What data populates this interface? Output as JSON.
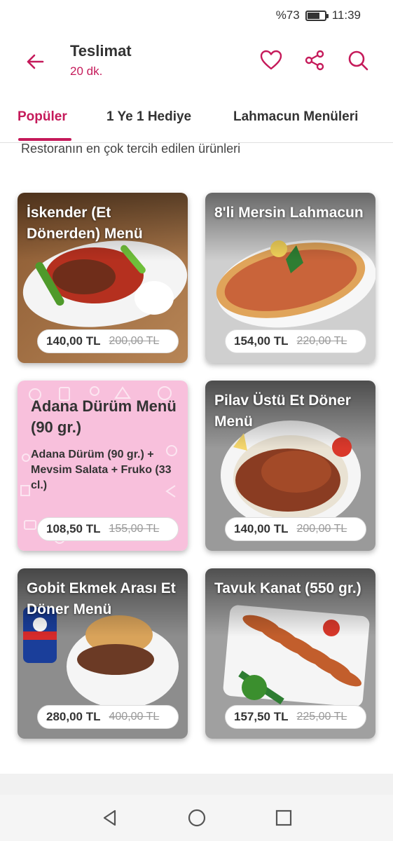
{
  "status_bar": {
    "battery": "%73",
    "time": "11:39",
    "battery_level": 0.73
  },
  "header": {
    "title": "Teslimat",
    "subtitle": "20 dk."
  },
  "icons": {
    "back": "arrow-left-icon",
    "favorite": "heart-icon",
    "share": "share-icon",
    "search": "search-icon"
  },
  "colors": {
    "accent": "#c51a5a",
    "pink_card": "#f8c0dc"
  },
  "tabs": [
    {
      "label": "Popüler",
      "active": true
    },
    {
      "label": "1 Ye 1 Hediye",
      "active": false
    },
    {
      "label": "Lahmacun Menüleri",
      "active": false
    }
  ],
  "section_caption": "Restoranın en çok tercih edilen ürünleri",
  "products": [
    {
      "title": "İskender (Et Dönerden) Menü",
      "price": "140,00 TL",
      "old_price": "200,00 TL"
    },
    {
      "title": "8'li Mersin Lahmacun",
      "price": "154,00 TL",
      "old_price": "220,00 TL"
    },
    {
      "title": "Adana Dürüm Menü (90 gr.)",
      "description": "Adana Dürüm (90 gr.) + Mevsim Salata + Fruko (33 cl.)",
      "price": "108,50 TL",
      "old_price": "155,00 TL"
    },
    {
      "title": "Pilav Üstü Et Döner Menü",
      "price": "140,00 TL",
      "old_price": "200,00 TL"
    },
    {
      "title": "Gobit Ekmek Arası Et Döner Menü",
      "price": "280,00 TL",
      "old_price": "400,00 TL"
    },
    {
      "title": "Tavuk Kanat (550 gr.)",
      "price": "157,50 TL",
      "old_price": "225,00 TL"
    }
  ],
  "nav": {
    "back": "nav-back-icon",
    "home": "nav-home-icon",
    "recents": "nav-recents-icon"
  }
}
